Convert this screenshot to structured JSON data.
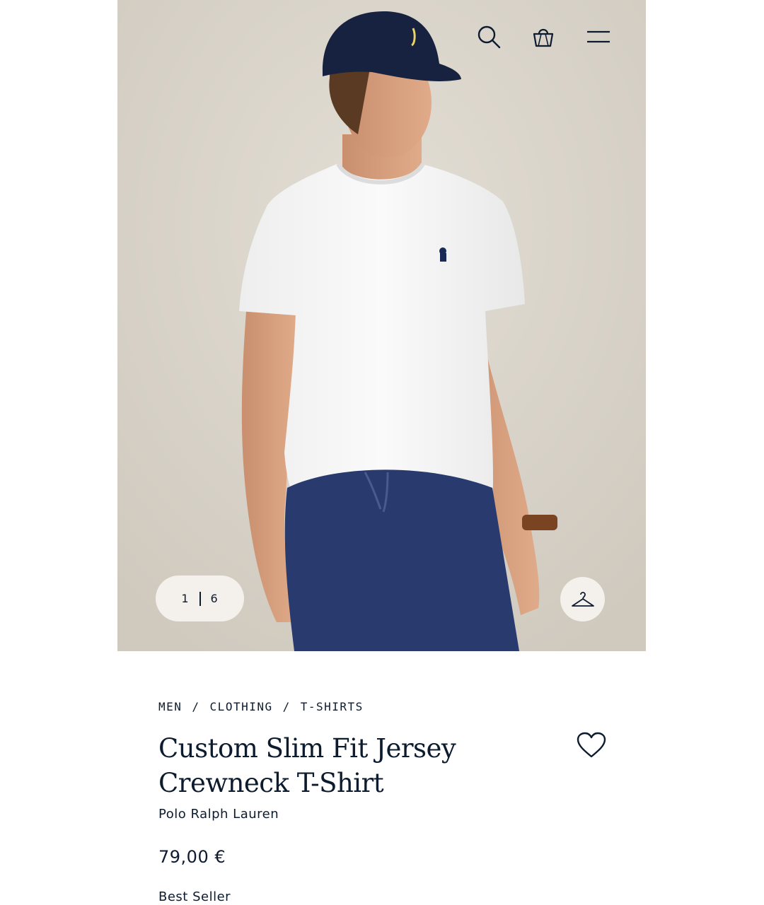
{
  "header": {
    "icons": [
      "search-icon",
      "shopping-bag-icon",
      "menu-icon"
    ]
  },
  "gallery": {
    "current_image": "1",
    "total_images": "6",
    "hanger_button_icon": "hanger-icon"
  },
  "breadcrumb": {
    "items": [
      "MEN",
      "CLOTHING",
      "T-SHIRTS"
    ],
    "separator": "/"
  },
  "product": {
    "title": "Custom Slim Fit Jersey Crewneck T-Shirt",
    "brand": "Polo Ralph Lauren",
    "price": "79,00 €",
    "badge": "Best Seller",
    "wishlist_icon": "heart-icon"
  },
  "colors": {
    "ink": "#0d1b2e",
    "backdrop": "#d9d4ca",
    "pill": "#f4f1ec",
    "cap": "#16223f",
    "shorts": "#283a6e"
  }
}
